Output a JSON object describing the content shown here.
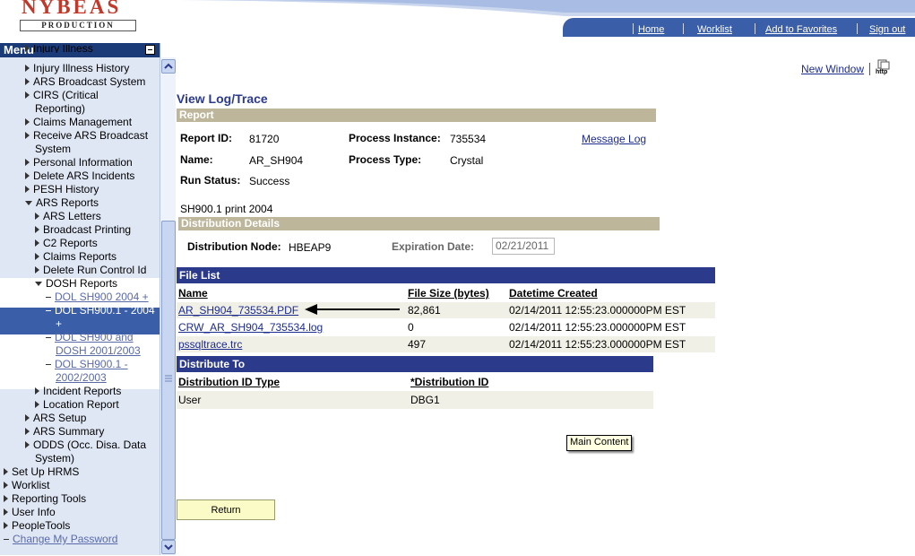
{
  "header": {
    "logo_name": "NYBEAS",
    "logo_sub": "PRODUCTION",
    "links": [
      "Home",
      "Worklist",
      "Add to Favorites",
      "Sign out"
    ]
  },
  "menu": {
    "title": "Menu",
    "items": [
      {
        "label": "Injury Illness",
        "type": "tri"
      },
      {
        "label": "Injury Illness History",
        "type": "tri"
      },
      {
        "label": "ARS Broadcast System",
        "type": "tri"
      },
      {
        "label": "CIRS (Critical",
        "type": "tri"
      },
      {
        "label": "Reporting)",
        "type": "cont"
      },
      {
        "label": "Claims Management",
        "type": "tri"
      },
      {
        "label": "Receive ARS Broadcast",
        "type": "tri"
      },
      {
        "label": "System",
        "type": "cont"
      },
      {
        "label": "Personal Information",
        "type": "tri"
      },
      {
        "label": "Delete ARS Incidents",
        "type": "tri"
      },
      {
        "label": "PESH History",
        "type": "tri"
      },
      {
        "label": "ARS Reports",
        "type": "down"
      },
      {
        "label": "ARS Letters",
        "type": "tri2"
      },
      {
        "label": "Broadcast Printing",
        "type": "tri2"
      },
      {
        "label": "C2 Reports",
        "type": "tri2"
      },
      {
        "label": "Claims Reports",
        "type": "tri2"
      },
      {
        "label": "Delete Run Control Id",
        "type": "tri2"
      },
      {
        "label": "DOSH Reports",
        "type": "down2"
      },
      {
        "label": "DOL SH900 2004 +",
        "type": "link"
      },
      {
        "label": "DOL SH900.1 - 2004",
        "type": "sel"
      },
      {
        "label": "+",
        "type": "selcont"
      },
      {
        "label": "DOL SH900 and",
        "type": "link"
      },
      {
        "label": "DOSH 2001/2003",
        "type": "linkcont"
      },
      {
        "label": "DOL SH900.1 -",
        "type": "link"
      },
      {
        "label": "2002/2003",
        "type": "linkcont"
      },
      {
        "label": "Incident Reports",
        "type": "tri2"
      },
      {
        "label": "Location Report",
        "type": "tri2"
      },
      {
        "label": "ARS Setup",
        "type": "tri"
      },
      {
        "label": "ARS Summary",
        "type": "tri"
      },
      {
        "label": "ODDS (Occ. Disa. Data",
        "type": "tri"
      },
      {
        "label": "System)",
        "type": "cont"
      },
      {
        "label": "Set Up HRMS",
        "type": "tri0"
      },
      {
        "label": "Worklist",
        "type": "tri0"
      },
      {
        "label": "Reporting Tools",
        "type": "tri0"
      },
      {
        "label": "User Info",
        "type": "tri0"
      },
      {
        "label": "PeopleTools",
        "type": "tri0"
      },
      {
        "label": "Change My Password",
        "type": "link0"
      }
    ]
  },
  "toolbar": {
    "new_window": "New Window",
    "http_icon": "http"
  },
  "page": {
    "title": "View Log/Trace",
    "report_header": "Report",
    "report_id_label": "Report ID:",
    "report_id": "81720",
    "process_instance_label": "Process Instance:",
    "process_instance": "735534",
    "message_log": "Message Log",
    "name_label": "Name:",
    "name": "AR_SH904",
    "process_type_label": "Process Type:",
    "process_type": "Crystal",
    "run_status_label": "Run Status:",
    "run_status": "Success",
    "description": "SH900.1 print 2004",
    "dist_header": "Distribution Details",
    "dist_node_label": "Distribution Node:",
    "dist_node": "HBEAP9",
    "exp_date_label": "Expiration Date:",
    "exp_date": "02/21/2011",
    "file_list_header": "File List",
    "file_columns": [
      "Name",
      "File Size (bytes)",
      "Datetime Created"
    ],
    "files": [
      {
        "name": "AR_SH904_735534.PDF",
        "size": "82,861",
        "created": "02/14/2011 12:55:23.000000PM EST"
      },
      {
        "name": "CRW_AR_SH904_735534.log",
        "size": "0",
        "created": "02/14/2011 12:55:23.000000PM EST"
      },
      {
        "name": "pssqltrace.trc",
        "size": "497",
        "created": "02/14/2011 12:55:23.000000PM EST"
      }
    ],
    "distribute_header": "Distribute To",
    "distribute_columns": [
      "Distribution ID Type",
      "*Distribution ID"
    ],
    "distribute_row": {
      "type": "User",
      "id": "DBG1"
    },
    "tooltip": "Main Content",
    "return_button": "Return"
  }
}
